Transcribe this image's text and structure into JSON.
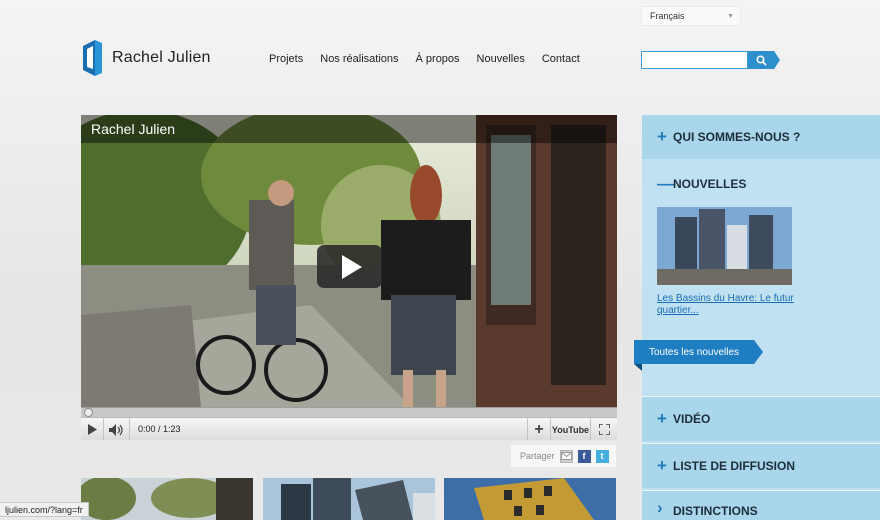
{
  "header": {
    "language": "Français",
    "logo_name": "Rachel Julien",
    "nav": [
      "Projets",
      "Nos réalisations",
      "À propos",
      "Nouvelles",
      "Contact"
    ],
    "search_placeholder": ""
  },
  "video": {
    "title": "Rachel Julien",
    "time": "0:00 / 1:23",
    "youtube_label": "YouTube"
  },
  "share": {
    "label": "Partager"
  },
  "sidebar": {
    "sections": [
      {
        "symbol": "+",
        "label": "QUI SOMMES-NOUS ?"
      },
      {
        "symbol": "—",
        "label": "NOUVELLES"
      },
      {
        "symbol": "+",
        "label": "VIDÉO"
      },
      {
        "symbol": "+",
        "label": "LISTE DE DIFFUSION"
      },
      {
        "symbol": "›",
        "label": "DISTINCTIONS"
      }
    ],
    "news_link": "Les Bassins du Havre: Le futur quartier...",
    "all_news": "Toutes les nouvelles"
  },
  "status_url": "ljulien.com/?lang=fr",
  "colors": {
    "accent": "#2e8fce",
    "sidebar_bg": "#c0e1f1",
    "sidebar_dark": "#a9d6eb"
  }
}
